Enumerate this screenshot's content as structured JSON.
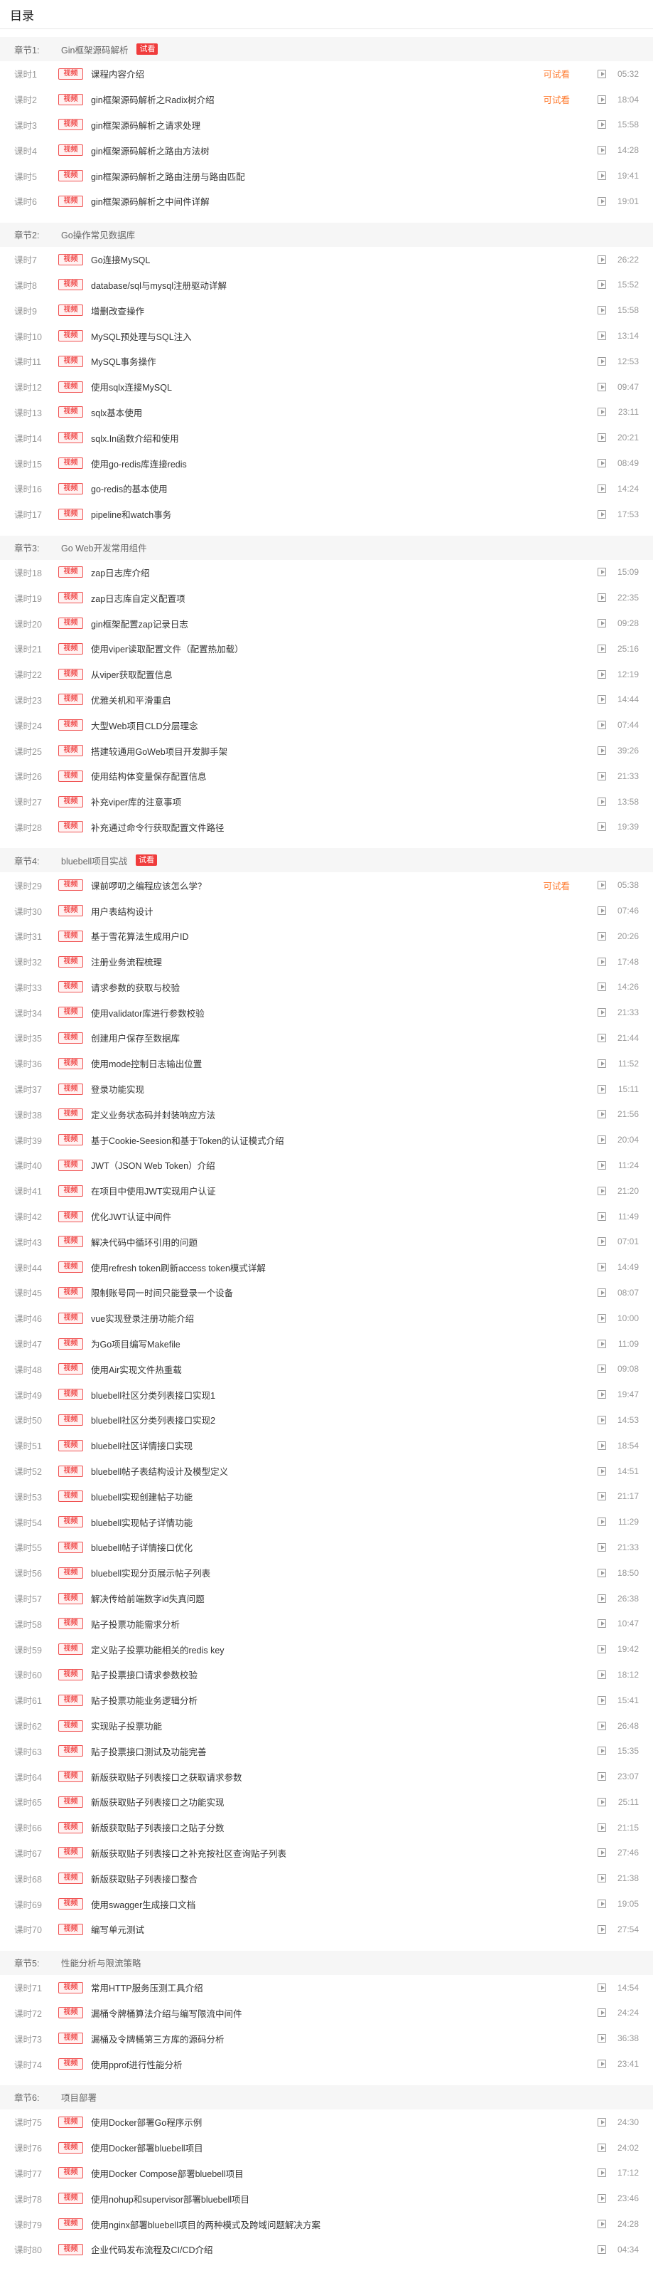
{
  "page": {
    "title": "目录"
  },
  "labels": {
    "trial": "试看",
    "preview": "可试看",
    "video": "视频"
  },
  "colors": {
    "accent": "#f05252",
    "preview": "#ff7a2e",
    "chapter_bg": "#f6f6f6"
  },
  "icons": {
    "play": "play-icon"
  },
  "chapters": [
    {
      "label": "章节1:",
      "title": "Gin框架源码解析",
      "trial": true,
      "lessons": [
        {
          "no": "课时1",
          "title": "课程内容介绍",
          "preview": true,
          "duration": "05:32"
        },
        {
          "no": "课时2",
          "title": "gin框架源码解析之Radix树介绍",
          "preview": true,
          "duration": "18:04"
        },
        {
          "no": "课时3",
          "title": "gin框架源码解析之请求处理",
          "preview": false,
          "duration": "15:58"
        },
        {
          "no": "课时4",
          "title": "gin框架源码解析之路由方法树",
          "preview": false,
          "duration": "14:28"
        },
        {
          "no": "课时5",
          "title": "gin框架源码解析之路由注册与路由匹配",
          "preview": false,
          "duration": "19:41"
        },
        {
          "no": "课时6",
          "title": "gin框架源码解析之中间件详解",
          "preview": false,
          "duration": "19:01"
        }
      ]
    },
    {
      "label": "章节2:",
      "title": "Go操作常见数据库",
      "trial": false,
      "lessons": [
        {
          "no": "课时7",
          "title": "Go连接MySQL",
          "preview": false,
          "duration": "26:22"
        },
        {
          "no": "课时8",
          "title": "database/sql与mysql注册驱动详解",
          "preview": false,
          "duration": "15:52"
        },
        {
          "no": "课时9",
          "title": "增删改查操作",
          "preview": false,
          "duration": "15:58"
        },
        {
          "no": "课时10",
          "title": "MySQL预处理与SQL注入",
          "preview": false,
          "duration": "13:14"
        },
        {
          "no": "课时11",
          "title": "MySQL事务操作",
          "preview": false,
          "duration": "12:53"
        },
        {
          "no": "课时12",
          "title": "使用sqlx连接MySQL",
          "preview": false,
          "duration": "09:47"
        },
        {
          "no": "课时13",
          "title": "sqlx基本使用",
          "preview": false,
          "duration": "23:11"
        },
        {
          "no": "课时14",
          "title": "sqlx.In函数介绍和使用",
          "preview": false,
          "duration": "20:21"
        },
        {
          "no": "课时15",
          "title": "使用go-redis库连接redis",
          "preview": false,
          "duration": "08:49"
        },
        {
          "no": "课时16",
          "title": "go-redis的基本使用",
          "preview": false,
          "duration": "14:24"
        },
        {
          "no": "课时17",
          "title": "pipeline和watch事务",
          "preview": false,
          "duration": "17:53"
        }
      ]
    },
    {
      "label": "章节3:",
      "title": "Go Web开发常用组件",
      "trial": false,
      "lessons": [
        {
          "no": "课时18",
          "title": "zap日志库介绍",
          "preview": false,
          "duration": "15:09"
        },
        {
          "no": "课时19",
          "title": "zap日志库自定义配置项",
          "preview": false,
          "duration": "22:35"
        },
        {
          "no": "课时20",
          "title": "gin框架配置zap记录日志",
          "preview": false,
          "duration": "09:28"
        },
        {
          "no": "课时21",
          "title": "使用viper读取配置文件（配置热加载）",
          "preview": false,
          "duration": "25:16"
        },
        {
          "no": "课时22",
          "title": "从viper获取配置信息",
          "preview": false,
          "duration": "12:19"
        },
        {
          "no": "课时23",
          "title": "优雅关机和平滑重启",
          "preview": false,
          "duration": "14:44"
        },
        {
          "no": "课时24",
          "title": "大型Web项目CLD分层理念",
          "preview": false,
          "duration": "07:44"
        },
        {
          "no": "课时25",
          "title": "搭建较通用GoWeb项目开发脚手架",
          "preview": false,
          "duration": "39:26"
        },
        {
          "no": "课时26",
          "title": "使用结构体变量保存配置信息",
          "preview": false,
          "duration": "21:33"
        },
        {
          "no": "课时27",
          "title": "补充viper库的注意事项",
          "preview": false,
          "duration": "13:58"
        },
        {
          "no": "课时28",
          "title": "补充通过命令行获取配置文件路径",
          "preview": false,
          "duration": "19:39"
        }
      ]
    },
    {
      "label": "章节4:",
      "title": "bluebell项目实战",
      "trial": true,
      "lessons": [
        {
          "no": "课时29",
          "title": "课前啰叨之编程应该怎么学？",
          "preview": true,
          "duration": "05:38"
        },
        {
          "no": "课时30",
          "title": "用户表结构设计",
          "preview": false,
          "duration": "07:46"
        },
        {
          "no": "课时31",
          "title": "基于雪花算法生成用户ID",
          "preview": false,
          "duration": "20:26"
        },
        {
          "no": "课时32",
          "title": "注册业务流程梳理",
          "preview": false,
          "duration": "17:48"
        },
        {
          "no": "课时33",
          "title": "请求参数的获取与校验",
          "preview": false,
          "duration": "14:26"
        },
        {
          "no": "课时34",
          "title": "使用validator库进行参数校验",
          "preview": false,
          "duration": "21:33"
        },
        {
          "no": "课时35",
          "title": "创建用户保存至数据库",
          "preview": false,
          "duration": "21:44"
        },
        {
          "no": "课时36",
          "title": "使用mode控制日志输出位置",
          "preview": false,
          "duration": "11:52"
        },
        {
          "no": "课时37",
          "title": "登录功能实现",
          "preview": false,
          "duration": "15:11"
        },
        {
          "no": "课时38",
          "title": "定义业务状态码并封装响应方法",
          "preview": false,
          "duration": "21:56"
        },
        {
          "no": "课时39",
          "title": "基于Cookie-Seesion和基于Token的认证模式介绍",
          "preview": false,
          "duration": "20:04"
        },
        {
          "no": "课时40",
          "title": "JWT（JSON Web Token）介绍",
          "preview": false,
          "duration": "11:24"
        },
        {
          "no": "课时41",
          "title": "在项目中使用JWT实现用户认证",
          "preview": false,
          "duration": "21:20"
        },
        {
          "no": "课时42",
          "title": "优化JWT认证中间件",
          "preview": false,
          "duration": "11:49"
        },
        {
          "no": "课时43",
          "title": "解决代码中循环引用的问题",
          "preview": false,
          "duration": "07:01"
        },
        {
          "no": "课时44",
          "title": "使用refresh token刷新access token模式详解",
          "preview": false,
          "duration": "14:49"
        },
        {
          "no": "课时45",
          "title": "限制账号同一时间只能登录一个设备",
          "preview": false,
          "duration": "08:07"
        },
        {
          "no": "课时46",
          "title": "vue实现登录注册功能介绍",
          "preview": false,
          "duration": "10:00"
        },
        {
          "no": "课时47",
          "title": "为Go项目编写Makefile",
          "preview": false,
          "duration": "11:09"
        },
        {
          "no": "课时48",
          "title": "使用Air实现文件热重载",
          "preview": false,
          "duration": "09:08"
        },
        {
          "no": "课时49",
          "title": "bluebell社区分类列表接口实现1",
          "preview": false,
          "duration": "19:47"
        },
        {
          "no": "课时50",
          "title": "bluebell社区分类列表接口实现2",
          "preview": false,
          "duration": "14:53"
        },
        {
          "no": "课时51",
          "title": "bluebell社区详情接口实现",
          "preview": false,
          "duration": "18:54"
        },
        {
          "no": "课时52",
          "title": "bluebell帖子表结构设计及模型定义",
          "preview": false,
          "duration": "14:51"
        },
        {
          "no": "课时53",
          "title": "bluebell实现创建帖子功能",
          "preview": false,
          "duration": "21:17"
        },
        {
          "no": "课时54",
          "title": "bluebell实现帖子详情功能",
          "preview": false,
          "duration": "11:29"
        },
        {
          "no": "课时55",
          "title": "bluebell帖子详情接口优化",
          "preview": false,
          "duration": "21:33"
        },
        {
          "no": "课时56",
          "title": "bluebell实现分页展示帖子列表",
          "preview": false,
          "duration": "18:50"
        },
        {
          "no": "课时57",
          "title": "解决传给前端数字id失真问题",
          "preview": false,
          "duration": "26:38"
        },
        {
          "no": "课时58",
          "title": "贴子投票功能需求分析",
          "preview": false,
          "duration": "10:47"
        },
        {
          "no": "课时59",
          "title": "定义贴子投票功能相关的redis key",
          "preview": false,
          "duration": "19:42"
        },
        {
          "no": "课时60",
          "title": "贴子投票接口请求参数校验",
          "preview": false,
          "duration": "18:12"
        },
        {
          "no": "课时61",
          "title": "贴子投票功能业务逻辑分析",
          "preview": false,
          "duration": "15:41"
        },
        {
          "no": "课时62",
          "title": "实现贴子投票功能",
          "preview": false,
          "duration": "26:48"
        },
        {
          "no": "课时63",
          "title": "贴子投票接口测试及功能完善",
          "preview": false,
          "duration": "15:35"
        },
        {
          "no": "课时64",
          "title": "新版获取贴子列表接口之获取请求参数",
          "preview": false,
          "duration": "23:07"
        },
        {
          "no": "课时65",
          "title": "新版获取贴子列表接口之功能实现",
          "preview": false,
          "duration": "25:11"
        },
        {
          "no": "课时66",
          "title": "新版获取贴子列表接口之贴子分数",
          "preview": false,
          "duration": "21:15"
        },
        {
          "no": "课时67",
          "title": "新版获取贴子列表接口之补充按社区查询贴子列表",
          "preview": false,
          "duration": "27:46"
        },
        {
          "no": "课时68",
          "title": "新版获取贴子列表接口整合",
          "preview": false,
          "duration": "21:38"
        },
        {
          "no": "课时69",
          "title": "使用swagger生成接口文档",
          "preview": false,
          "duration": "19:05"
        },
        {
          "no": "课时70",
          "title": "编写单元测试",
          "preview": false,
          "duration": "27:54"
        }
      ]
    },
    {
      "label": "章节5:",
      "title": "性能分析与限流策略",
      "trial": false,
      "lessons": [
        {
          "no": "课时71",
          "title": "常用HTTP服务压测工具介绍",
          "preview": false,
          "duration": "14:54"
        },
        {
          "no": "课时72",
          "title": "漏桶令牌桶算法介绍与编写限流中间件",
          "preview": false,
          "duration": "24:24"
        },
        {
          "no": "课时73",
          "title": "漏桶及令牌桶第三方库的源码分析",
          "preview": false,
          "duration": "36:38"
        },
        {
          "no": "课时74",
          "title": "使用pprof进行性能分析",
          "preview": false,
          "duration": "23:41"
        }
      ]
    },
    {
      "label": "章节6:",
      "title": "项目部署",
      "trial": false,
      "lessons": [
        {
          "no": "课时75",
          "title": "使用Docker部署Go程序示例",
          "preview": false,
          "duration": "24:30"
        },
        {
          "no": "课时76",
          "title": "使用Docker部署bluebell项目",
          "preview": false,
          "duration": "24:02"
        },
        {
          "no": "课时77",
          "title": "使用Docker Compose部署bluebell项目",
          "preview": false,
          "duration": "17:12"
        },
        {
          "no": "课时78",
          "title": "使用nohup和supervisor部署bluebell项目",
          "preview": false,
          "duration": "23:46"
        },
        {
          "no": "课时79",
          "title": "使用nginx部署bluebell项目的两种模式及跨域问题解决方案",
          "preview": false,
          "duration": "24:28"
        },
        {
          "no": "课时80",
          "title": "企业代码发布流程及CI/CD介绍",
          "preview": false,
          "duration": "04:34"
        }
      ]
    }
  ]
}
